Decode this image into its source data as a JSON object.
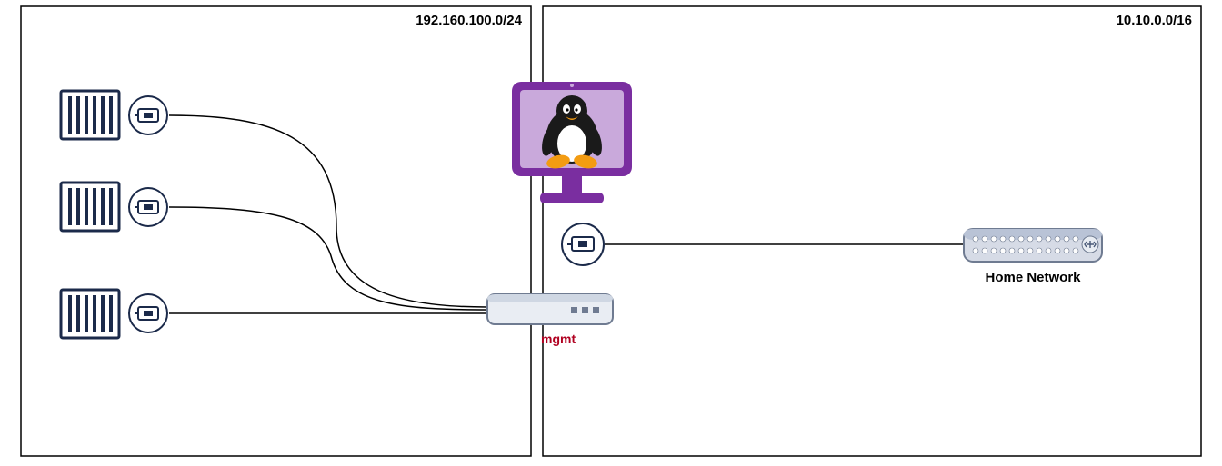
{
  "networks": {
    "left": {
      "cidr": "192.160.100.0/24"
    },
    "right": {
      "cidr": "10.10.0.0/16"
    }
  },
  "bridge_label": "mgmt",
  "home_switch_label": "Home Network",
  "containers": [
    {
      "id": "c1"
    },
    {
      "id": "c2"
    },
    {
      "id": "c3"
    }
  ],
  "host": {
    "os": "linux"
  }
}
